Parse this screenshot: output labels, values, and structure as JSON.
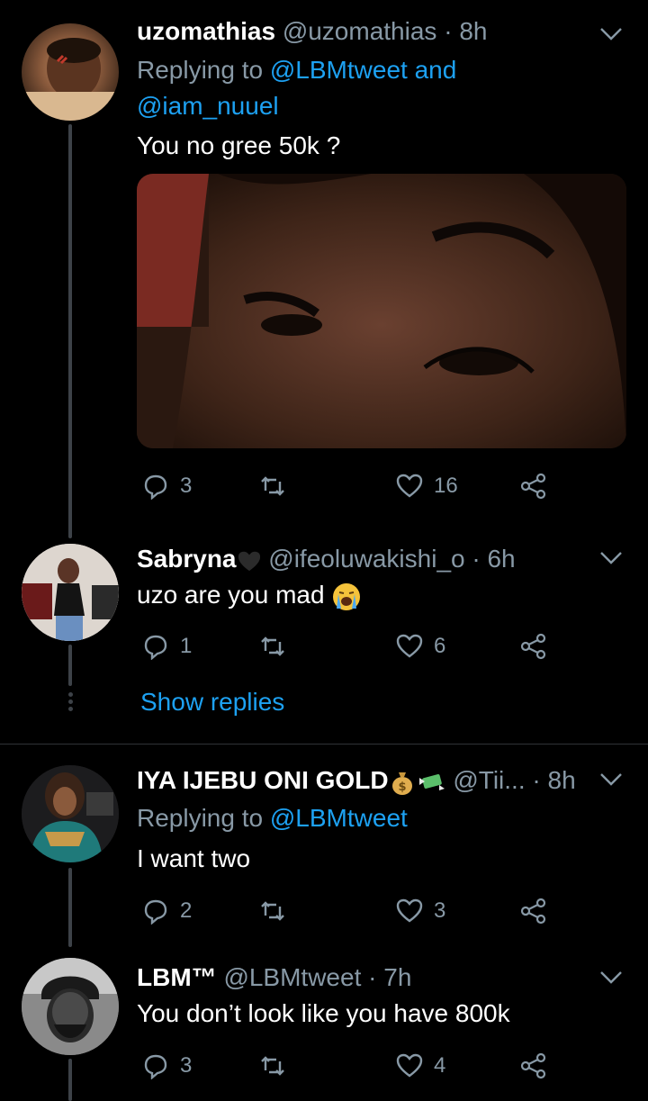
{
  "tweets": [
    {
      "name": "uzomathias",
      "handle": "@uzomathias",
      "time": "8h",
      "replying_prefix": "Replying to ",
      "replying_to_1": "@LBMtweet",
      "replying_and": " and",
      "replying_to_2": "@iam_nuuel",
      "text": "You no gree 50k ?",
      "replies": "3",
      "retweets": "",
      "likes": "16",
      "has_media": true
    },
    {
      "name": "Sabryna",
      "name_emoji": "black-heart",
      "handle": "@ifeoluwakishi_o",
      "time": "6h",
      "text": "uzo are you mad",
      "text_emoji": "loudly-crying-face",
      "replies": "1",
      "retweets": "",
      "likes": "6"
    },
    {
      "name": "IYA IJEBU ONI GOLD",
      "name_emojis": [
        "money-bag",
        "money-with-wings"
      ],
      "handle": "@Tii...",
      "time": "8h",
      "replying_prefix": "Replying to ",
      "replying_to_1": "@LBMtweet",
      "text": "I want two",
      "replies": "2",
      "retweets": "",
      "likes": "3"
    },
    {
      "name": "LBM™",
      "handle": "@LBMtweet",
      "time": "7h",
      "text": "You don’t look like you have 800k",
      "replies": "3",
      "retweets": "",
      "likes": "4"
    }
  ],
  "show_replies_label": "Show replies",
  "separator": " · ",
  "colors": {
    "background": "#000000",
    "accent": "#1da1f2",
    "muted": "#8899a6",
    "thread_line": "#3d4248"
  },
  "icons": [
    "reply-icon",
    "retweet-icon",
    "like-icon",
    "share-icon",
    "chevron-down-icon"
  ]
}
